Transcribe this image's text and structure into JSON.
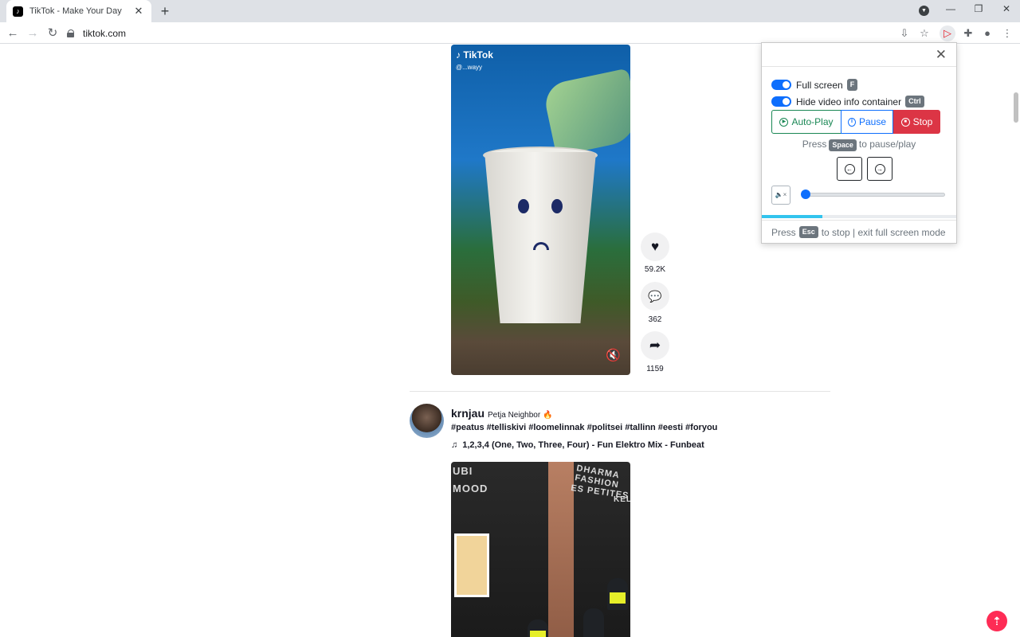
{
  "browser": {
    "tab_title": "TikTok - Make Your Day",
    "tab_close": "✕",
    "new_tab": "+",
    "url": "tiktok.com"
  },
  "video1": {
    "logo": "♪ TikTok",
    "handle": "@...wayy",
    "likes": "59.2K",
    "comments": "362",
    "shares": "1159"
  },
  "post2": {
    "author": "krnjau",
    "nickname": "Petja Neighbor 🔥",
    "hashtags": "#peatus #telliskivi #loomelinnak #politsei #tallinn #eesti #foryou",
    "music_icon": "♫",
    "music": "1,2,3,4 (One, Two, Three, Four) - Fun Elektro Mix - Funbeat",
    "signs": [
      "UBI",
      "MOOD",
      "DHARMA FASHION",
      "ES PETITES",
      "KELP"
    ]
  },
  "popup": {
    "close": "✕",
    "fullscreen_label": "Full screen",
    "fullscreen_key": "F",
    "hide_info_label": "Hide video info container",
    "hide_info_key": "Ctrl",
    "autoplay_label": "Auto-Play",
    "pause_label": "Pause",
    "stop_label": "Stop",
    "hint_press": "Press",
    "hint_key": "Space",
    "hint_rest": "to pause/play",
    "prev_icon": "←",
    "next_icon": "→",
    "volume_icon": "🔈×",
    "volume_level": 0,
    "progress_fraction": 0.31,
    "footer_press": "Press",
    "footer_key": "Esc",
    "footer_rest": "to stop | exit full screen mode"
  },
  "colors": {
    "accent_blue": "#0d6efd",
    "accent_green": "#198754",
    "accent_red": "#dc3545",
    "tiktok_pink": "#fe2c55",
    "progress_cyan": "#33c4ee"
  }
}
